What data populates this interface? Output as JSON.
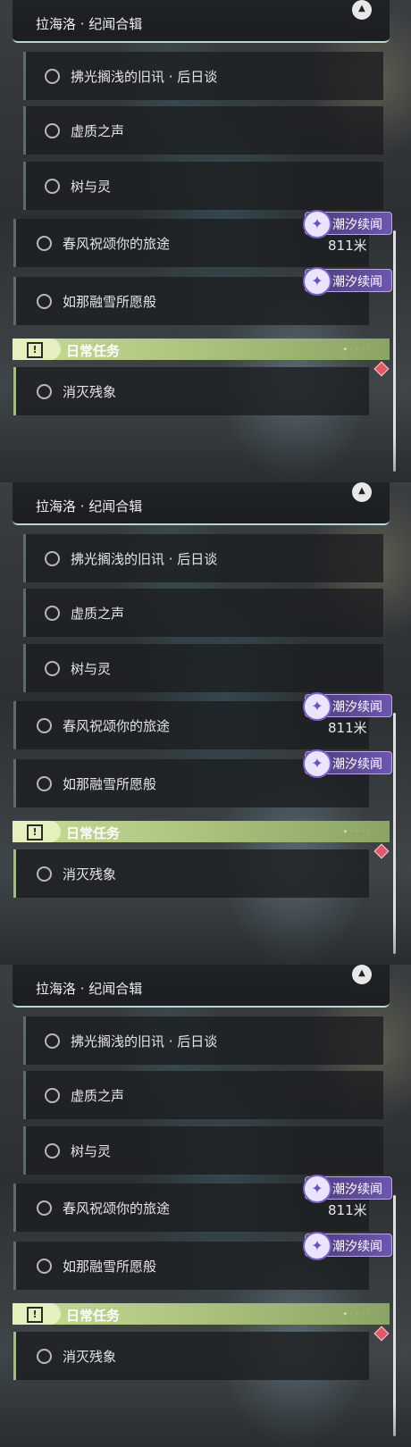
{
  "colors": {
    "badge": "#6e56b0",
    "daily_accent": "#b1c882",
    "header_underline": "#b8d4dc",
    "marker": "#e05a6a"
  },
  "panels": [
    {
      "header": {
        "title": "拉海洛 · 纪闻合辑",
        "button_icon": "chevron-up-icon",
        "button_glyph": "▲"
      },
      "subquests": [
        {
          "label": "拂光搁浅的旧讯 · 后日谈"
        },
        {
          "label": "虚质之声"
        },
        {
          "label": "树与灵"
        }
      ],
      "quests": [
        {
          "label": "春风祝颂你的旅途",
          "badge": "潮汐续闻",
          "distance": "811米"
        },
        {
          "label": "如那融雪所愿般",
          "badge": "潮汐续闻"
        }
      ],
      "daily": {
        "title": "日常任务",
        "icon_glyph": "!",
        "items": [
          {
            "label": "消灭残象"
          }
        ]
      }
    },
    {
      "header": {
        "title": "拉海洛 · 纪闻合辑",
        "button_icon": "chevron-up-icon",
        "button_glyph": "▲"
      },
      "subquests": [
        {
          "label": "拂光搁浅的旧讯 · 后日谈"
        },
        {
          "label": "虚质之声"
        },
        {
          "label": "树与灵"
        }
      ],
      "quests": [
        {
          "label": "春风祝颂你的旅途",
          "badge": "潮汐续闻",
          "distance": "811米"
        },
        {
          "label": "如那融雪所愿般",
          "badge": "潮汐续闻"
        }
      ],
      "daily": {
        "title": "日常任务",
        "icon_glyph": "!",
        "items": [
          {
            "label": "消灭残象"
          }
        ]
      }
    },
    {
      "header": {
        "title": "拉海洛 · 纪闻合辑",
        "button_icon": "chevron-up-icon",
        "button_glyph": "▲"
      },
      "subquests": [
        {
          "label": "拂光搁浅的旧讯 · 后日谈"
        },
        {
          "label": "虚质之声"
        },
        {
          "label": "树与灵"
        }
      ],
      "quests": [
        {
          "label": "春风祝颂你的旅途",
          "badge": "潮汐续闻",
          "distance": "811米"
        },
        {
          "label": "如那融雪所愿般",
          "badge": "潮汐续闻"
        }
      ],
      "daily": {
        "title": "日常任务",
        "icon_glyph": "!",
        "items": [
          {
            "label": "消灭残象"
          }
        ]
      }
    }
  ]
}
